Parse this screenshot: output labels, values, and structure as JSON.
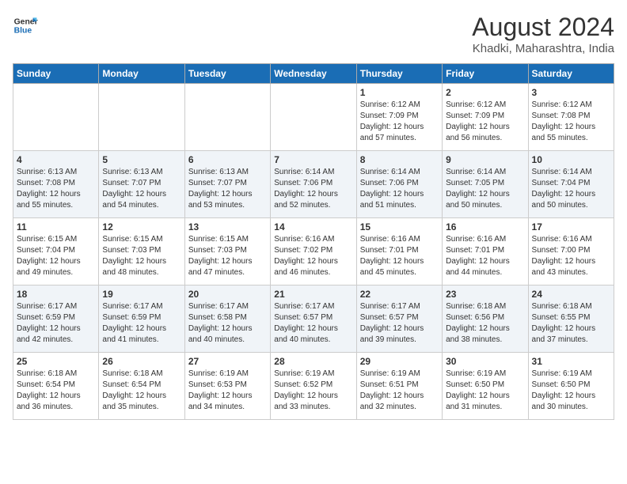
{
  "header": {
    "logo_line1": "General",
    "logo_line2": "Blue",
    "month_year": "August 2024",
    "location": "Khadki, Maharashtra, India"
  },
  "days_of_week": [
    "Sunday",
    "Monday",
    "Tuesday",
    "Wednesday",
    "Thursday",
    "Friday",
    "Saturday"
  ],
  "weeks": [
    [
      {
        "day": "",
        "info": ""
      },
      {
        "day": "",
        "info": ""
      },
      {
        "day": "",
        "info": ""
      },
      {
        "day": "",
        "info": ""
      },
      {
        "day": "1",
        "info": "Sunrise: 6:12 AM\nSunset: 7:09 PM\nDaylight: 12 hours\nand 57 minutes."
      },
      {
        "day": "2",
        "info": "Sunrise: 6:12 AM\nSunset: 7:09 PM\nDaylight: 12 hours\nand 56 minutes."
      },
      {
        "day": "3",
        "info": "Sunrise: 6:12 AM\nSunset: 7:08 PM\nDaylight: 12 hours\nand 55 minutes."
      }
    ],
    [
      {
        "day": "4",
        "info": "Sunrise: 6:13 AM\nSunset: 7:08 PM\nDaylight: 12 hours\nand 55 minutes."
      },
      {
        "day": "5",
        "info": "Sunrise: 6:13 AM\nSunset: 7:07 PM\nDaylight: 12 hours\nand 54 minutes."
      },
      {
        "day": "6",
        "info": "Sunrise: 6:13 AM\nSunset: 7:07 PM\nDaylight: 12 hours\nand 53 minutes."
      },
      {
        "day": "7",
        "info": "Sunrise: 6:14 AM\nSunset: 7:06 PM\nDaylight: 12 hours\nand 52 minutes."
      },
      {
        "day": "8",
        "info": "Sunrise: 6:14 AM\nSunset: 7:06 PM\nDaylight: 12 hours\nand 51 minutes."
      },
      {
        "day": "9",
        "info": "Sunrise: 6:14 AM\nSunset: 7:05 PM\nDaylight: 12 hours\nand 50 minutes."
      },
      {
        "day": "10",
        "info": "Sunrise: 6:14 AM\nSunset: 7:04 PM\nDaylight: 12 hours\nand 50 minutes."
      }
    ],
    [
      {
        "day": "11",
        "info": "Sunrise: 6:15 AM\nSunset: 7:04 PM\nDaylight: 12 hours\nand 49 minutes."
      },
      {
        "day": "12",
        "info": "Sunrise: 6:15 AM\nSunset: 7:03 PM\nDaylight: 12 hours\nand 48 minutes."
      },
      {
        "day": "13",
        "info": "Sunrise: 6:15 AM\nSunset: 7:03 PM\nDaylight: 12 hours\nand 47 minutes."
      },
      {
        "day": "14",
        "info": "Sunrise: 6:16 AM\nSunset: 7:02 PM\nDaylight: 12 hours\nand 46 minutes."
      },
      {
        "day": "15",
        "info": "Sunrise: 6:16 AM\nSunset: 7:01 PM\nDaylight: 12 hours\nand 45 minutes."
      },
      {
        "day": "16",
        "info": "Sunrise: 6:16 AM\nSunset: 7:01 PM\nDaylight: 12 hours\nand 44 minutes."
      },
      {
        "day": "17",
        "info": "Sunrise: 6:16 AM\nSunset: 7:00 PM\nDaylight: 12 hours\nand 43 minutes."
      }
    ],
    [
      {
        "day": "18",
        "info": "Sunrise: 6:17 AM\nSunset: 6:59 PM\nDaylight: 12 hours\nand 42 minutes."
      },
      {
        "day": "19",
        "info": "Sunrise: 6:17 AM\nSunset: 6:59 PM\nDaylight: 12 hours\nand 41 minutes."
      },
      {
        "day": "20",
        "info": "Sunrise: 6:17 AM\nSunset: 6:58 PM\nDaylight: 12 hours\nand 40 minutes."
      },
      {
        "day": "21",
        "info": "Sunrise: 6:17 AM\nSunset: 6:57 PM\nDaylight: 12 hours\nand 40 minutes."
      },
      {
        "day": "22",
        "info": "Sunrise: 6:17 AM\nSunset: 6:57 PM\nDaylight: 12 hours\nand 39 minutes."
      },
      {
        "day": "23",
        "info": "Sunrise: 6:18 AM\nSunset: 6:56 PM\nDaylight: 12 hours\nand 38 minutes."
      },
      {
        "day": "24",
        "info": "Sunrise: 6:18 AM\nSunset: 6:55 PM\nDaylight: 12 hours\nand 37 minutes."
      }
    ],
    [
      {
        "day": "25",
        "info": "Sunrise: 6:18 AM\nSunset: 6:54 PM\nDaylight: 12 hours\nand 36 minutes."
      },
      {
        "day": "26",
        "info": "Sunrise: 6:18 AM\nSunset: 6:54 PM\nDaylight: 12 hours\nand 35 minutes."
      },
      {
        "day": "27",
        "info": "Sunrise: 6:19 AM\nSunset: 6:53 PM\nDaylight: 12 hours\nand 34 minutes."
      },
      {
        "day": "28",
        "info": "Sunrise: 6:19 AM\nSunset: 6:52 PM\nDaylight: 12 hours\nand 33 minutes."
      },
      {
        "day": "29",
        "info": "Sunrise: 6:19 AM\nSunset: 6:51 PM\nDaylight: 12 hours\nand 32 minutes."
      },
      {
        "day": "30",
        "info": "Sunrise: 6:19 AM\nSunset: 6:50 PM\nDaylight: 12 hours\nand 31 minutes."
      },
      {
        "day": "31",
        "info": "Sunrise: 6:19 AM\nSunset: 6:50 PM\nDaylight: 12 hours\nand 30 minutes."
      }
    ]
  ]
}
